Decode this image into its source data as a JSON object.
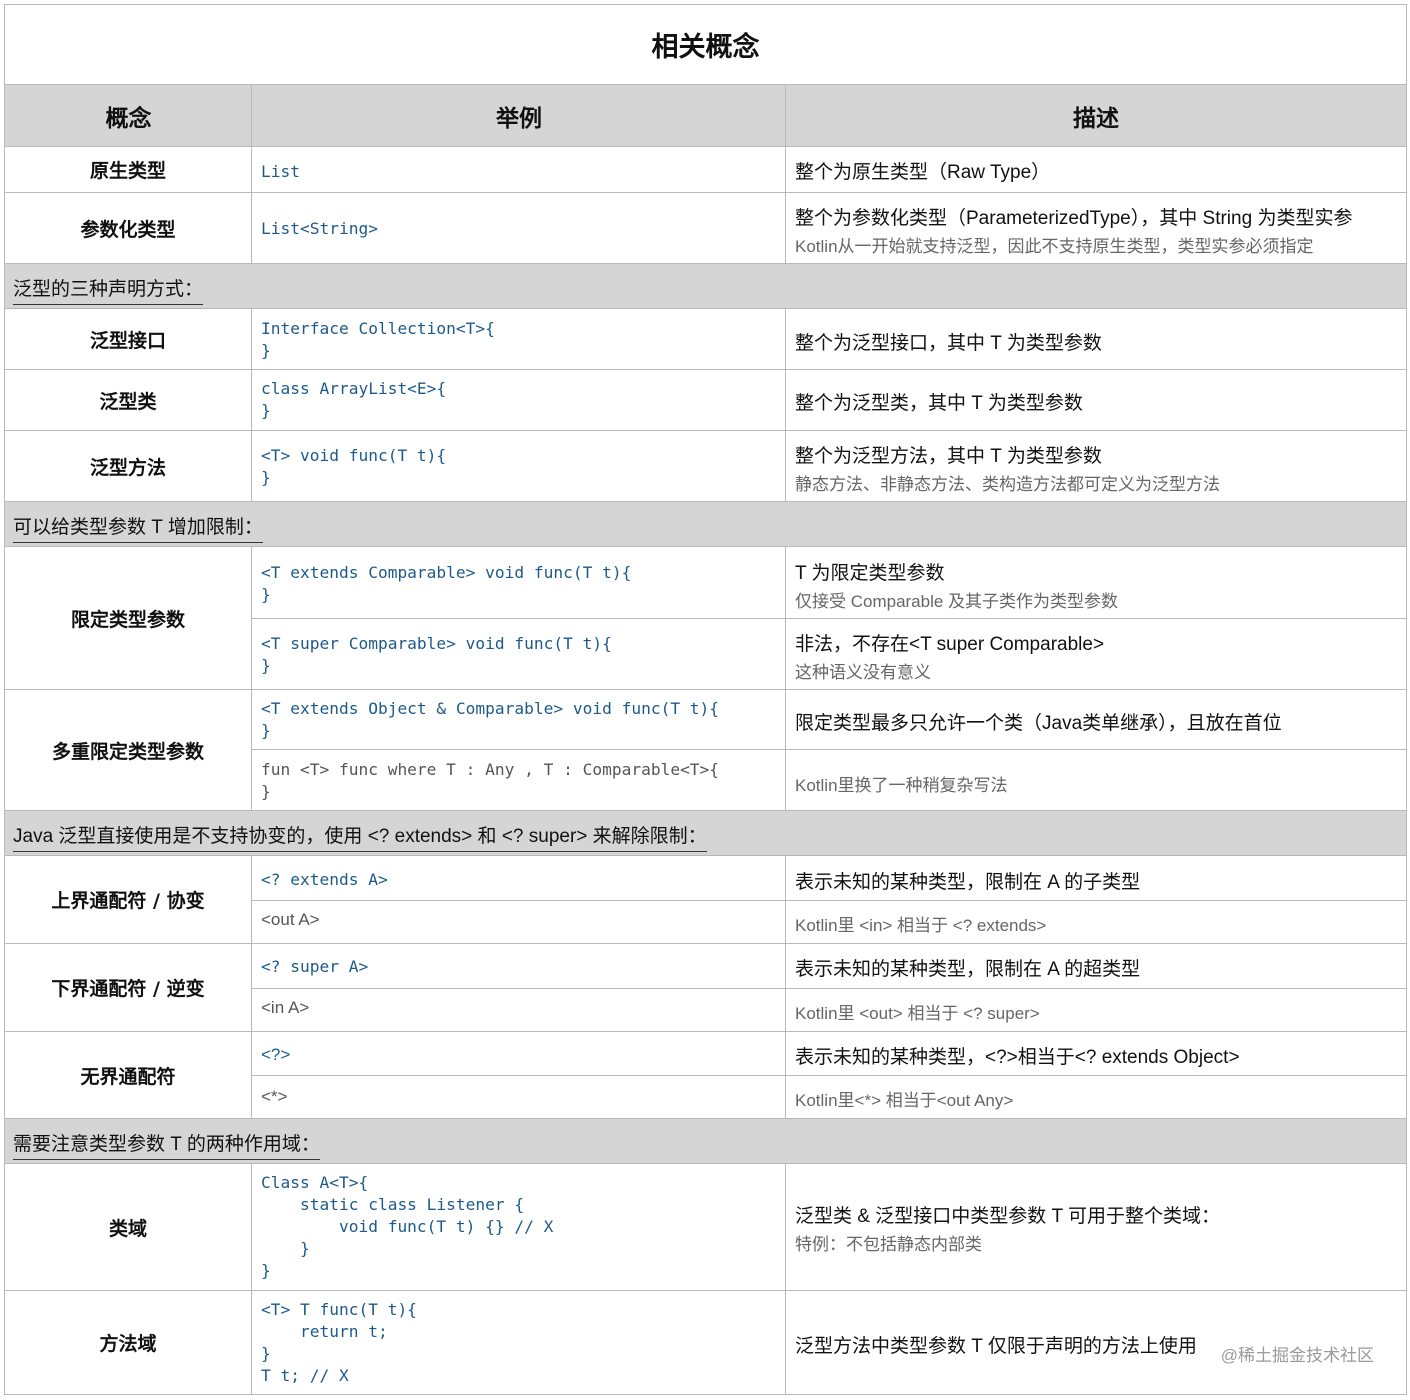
{
  "title": "相关概念",
  "headers": {
    "concept": "概念",
    "example": "举例",
    "description": "描述"
  },
  "rows": {
    "raw": {
      "concept": "原生类型",
      "code": "List",
      "desc": "整个为原生类型（Raw Type）"
    },
    "param": {
      "concept": "参数化类型",
      "code": "List<String>",
      "desc": "整个为参数化类型（ParameterizedType），其中 String 为类型实参",
      "sub": "Kotlin从一开始就支持泛型，因此不支持原生类型，类型实参必须指定"
    },
    "section1": "泛型的三种声明方式：",
    "iface": {
      "concept": "泛型接口",
      "code": "Interface Collection<T>{\n}",
      "desc": "整个为泛型接口，其中 T 为类型参数"
    },
    "cls": {
      "concept": "泛型类",
      "code": "class ArrayList<E>{\n}",
      "desc": "整个为泛型类，其中 T 为类型参数"
    },
    "method": {
      "concept": "泛型方法",
      "code": "<T> void func(T t){\n}",
      "desc": "整个为泛型方法，其中 T 为类型参数",
      "sub": "静态方法、非静态方法、类构造方法都可定义为泛型方法"
    },
    "section2": "可以给类型参数 T 增加限制：",
    "bounded": {
      "concept": "限定类型参数",
      "code1": "<T extends Comparable> void func(T t){\n}",
      "desc1": "T 为限定类型参数",
      "sub1": "仅接受 Comparable 及其子类作为类型参数",
      "code2": "<T super Comparable> void func(T t){\n}",
      "desc2": "非法，不存在<T super Comparable>",
      "sub2": "这种语义没有意义"
    },
    "multi": {
      "concept": "多重限定类型参数",
      "code1": "<T extends Object & Comparable> void func(T t){\n}",
      "desc1": "限定类型最多只允许一个类（Java类单继承），且放在首位",
      "code2": "fun <T> func where T : Any , T : Comparable<T>{\n}",
      "sub2": "Kotlin里换了一种稍复杂写法"
    },
    "section3": "Java 泛型直接使用是不支持协变的，使用 <? extends> 和 <? super> 来解除限制：",
    "upper": {
      "concept": "上界通配符 / 协变",
      "code1": "<? extends A>",
      "desc1": "表示未知的某种类型，限制在 A 的子类型",
      "code2": "<out A>",
      "sub2": "Kotlin里 <in> 相当于 <? extends>"
    },
    "lower": {
      "concept": "下界通配符 / 逆变",
      "code1": "<? super A>",
      "desc1": "表示未知的某种类型，限制在 A 的超类型",
      "code2": "<in A>",
      "sub2": "Kotlin里 <out> 相当于 <? super>"
    },
    "unbounded": {
      "concept": "无界通配符",
      "code1": "<?>",
      "desc1": "表示未知的某种类型，<?>相当于<? extends Object>",
      "code2": "<*>",
      "sub2": "Kotlin里<*> 相当于<out Any>"
    },
    "section4": "需要注意类型参数 T 的两种作用域：",
    "classScope": {
      "concept": "类域",
      "code": "Class A<T>{\n    static class Listener {\n        void func(T t) {} // X\n    }\n}",
      "desc": "泛型类 & 泛型接口中类型参数 T 可用于整个类域：",
      "sub": "特例：不包括静态内部类"
    },
    "methodScope": {
      "concept": "方法域",
      "code": "<T> T func(T t){\n    return t;\n}\nT t; // X",
      "desc": "泛型方法中类型参数 T 仅限于声明的方法上使用"
    }
  },
  "watermark": "@稀土掘金技术社区"
}
